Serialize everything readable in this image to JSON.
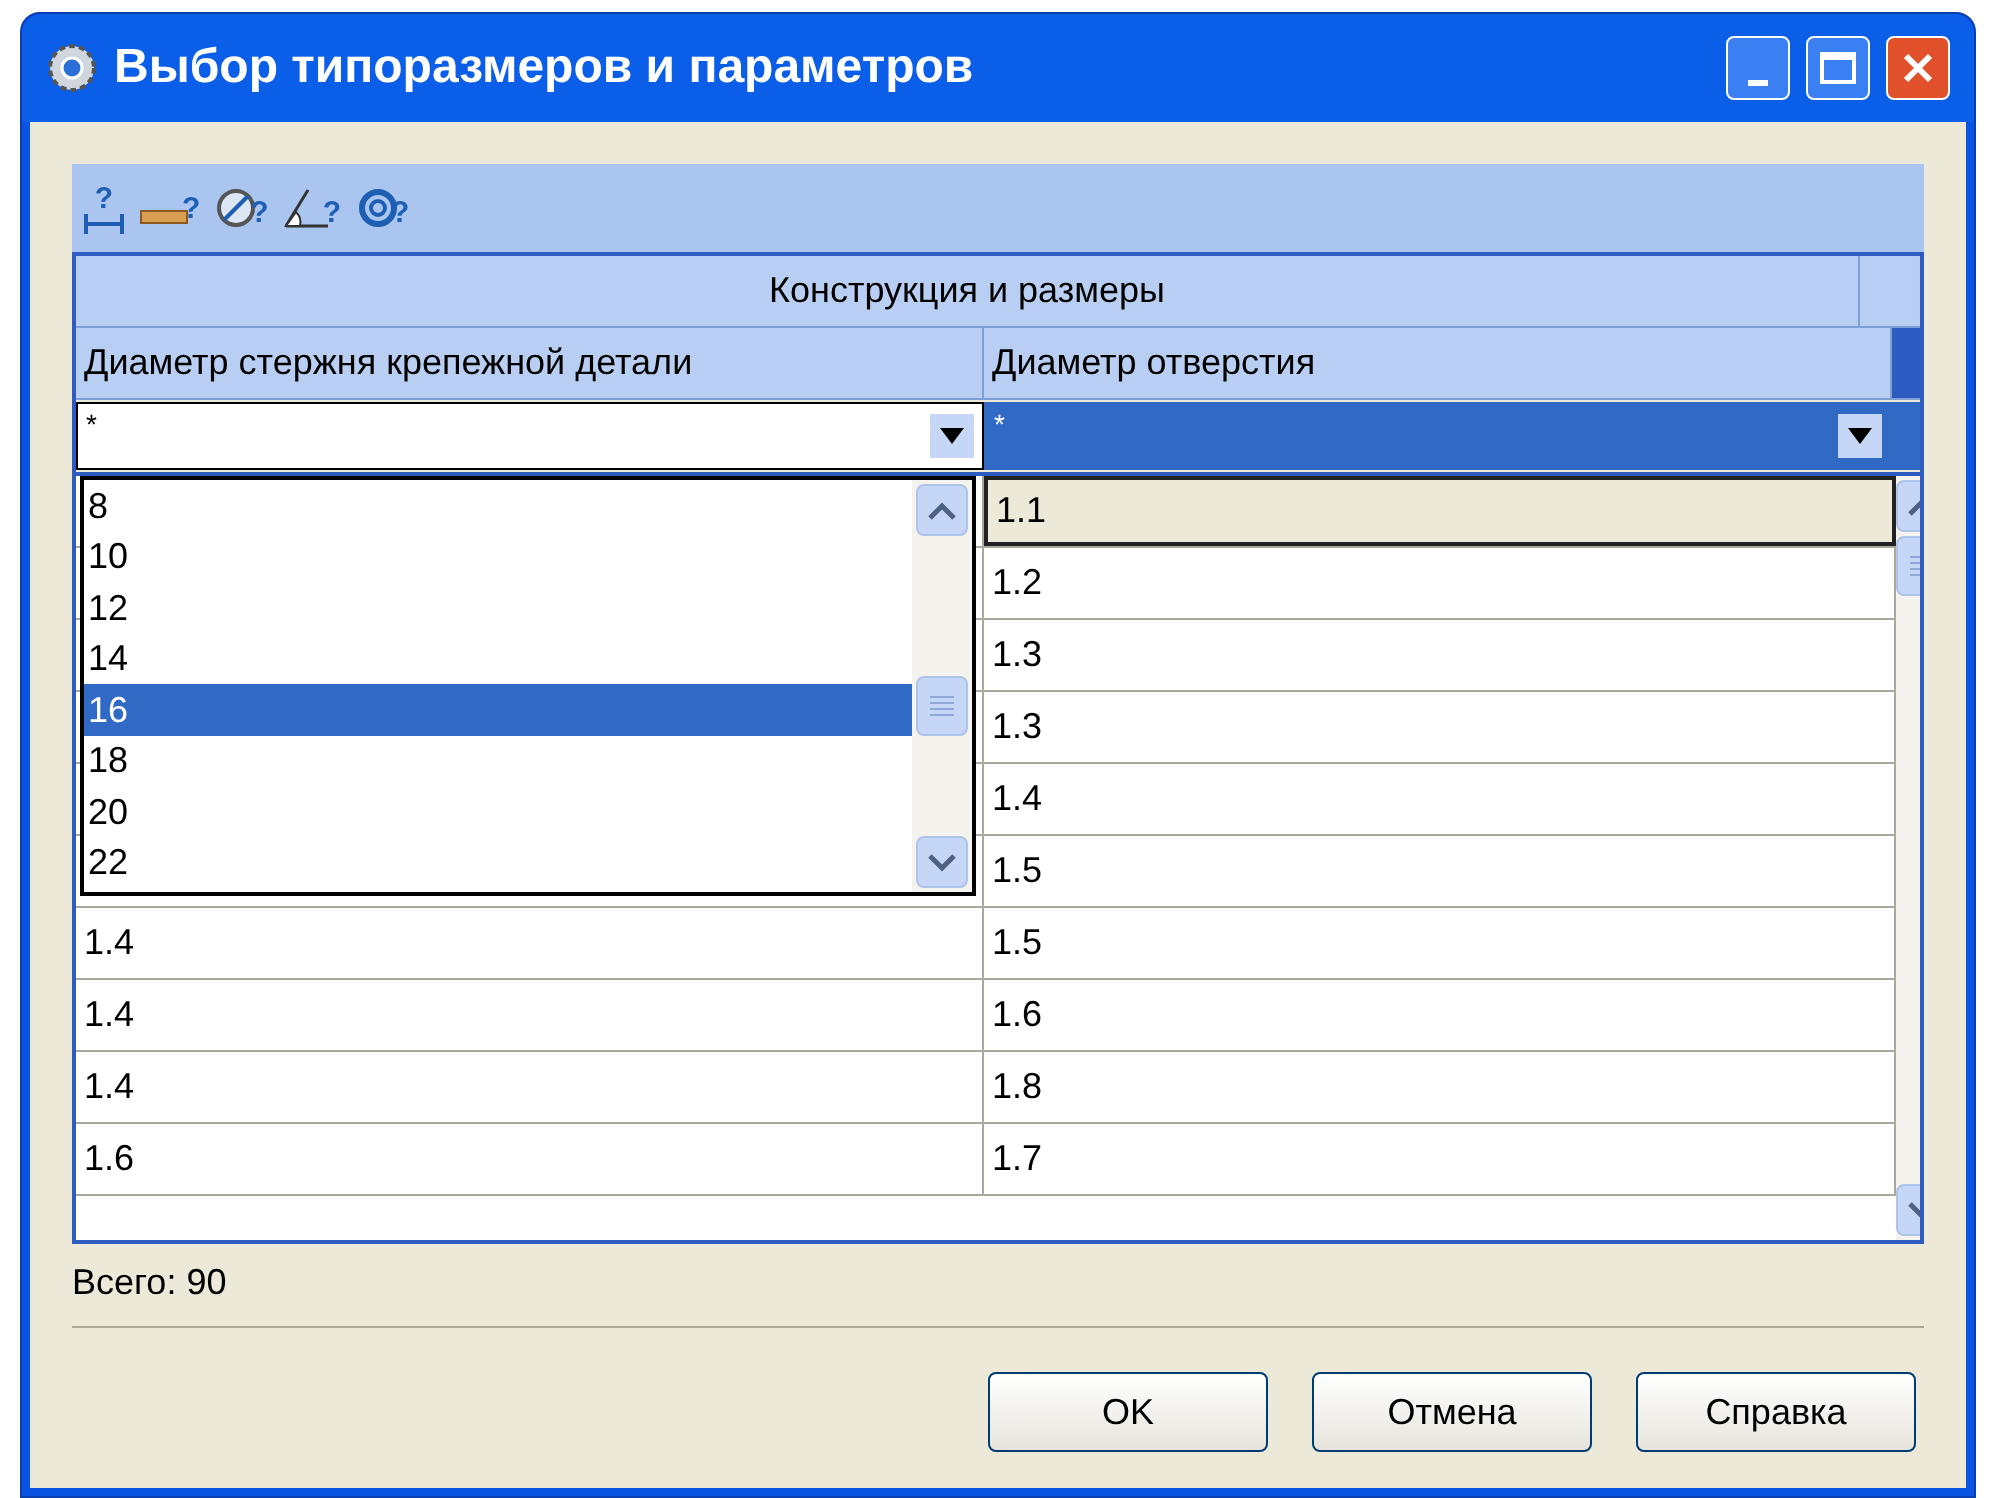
{
  "window": {
    "title": "Выбор типоразмеров и параметров"
  },
  "toolbar": {
    "buttons": [
      {
        "kind": "dimension",
        "label": "?"
      },
      {
        "kind": "ruler",
        "label": "?"
      },
      {
        "kind": "diameter",
        "label": "?"
      },
      {
        "kind": "angle",
        "label": "?"
      },
      {
        "kind": "radius",
        "label": "?"
      }
    ]
  },
  "table": {
    "group_header": "Конструкция и размеры",
    "columns": [
      {
        "label": "Диаметр стержня крепежной детали"
      },
      {
        "label": "Диаметр отверстия"
      }
    ],
    "filters": [
      {
        "value": "*",
        "selected": false
      },
      {
        "value": "*",
        "selected": true
      }
    ],
    "rows": [
      {
        "column_2": "1.1",
        "selected": true
      },
      {
        "column_2": "1.2",
        "selected": false
      },
      {
        "column_2": "1.3",
        "selected": false
      },
      {
        "column_2": "1.3",
        "selected": false
      },
      {
        "column_2": "1.4",
        "selected": false
      },
      {
        "column_2": "1.5",
        "selected": false
      },
      {
        "column_1": "1.4",
        "column_2": "1.5",
        "selected": false
      },
      {
        "column_1": "1.4",
        "column_2": "1.6",
        "selected": false
      },
      {
        "column_1": "1.4",
        "column_2": "1.8",
        "selected": false
      },
      {
        "column_1": "1.6",
        "column_2": "1.7",
        "selected": false
      }
    ]
  },
  "dropdown": {
    "items": [
      {
        "label": "8",
        "selected": false
      },
      {
        "label": "10",
        "selected": false
      },
      {
        "label": "12",
        "selected": false
      },
      {
        "label": "14",
        "selected": false
      },
      {
        "label": "16",
        "selected": true
      },
      {
        "label": "18",
        "selected": false
      },
      {
        "label": "20",
        "selected": false
      },
      {
        "label": "22",
        "selected": false
      }
    ]
  },
  "status": "Всего: 90",
  "buttons": [
    "OK",
    "Отмена",
    "Справка"
  ]
}
